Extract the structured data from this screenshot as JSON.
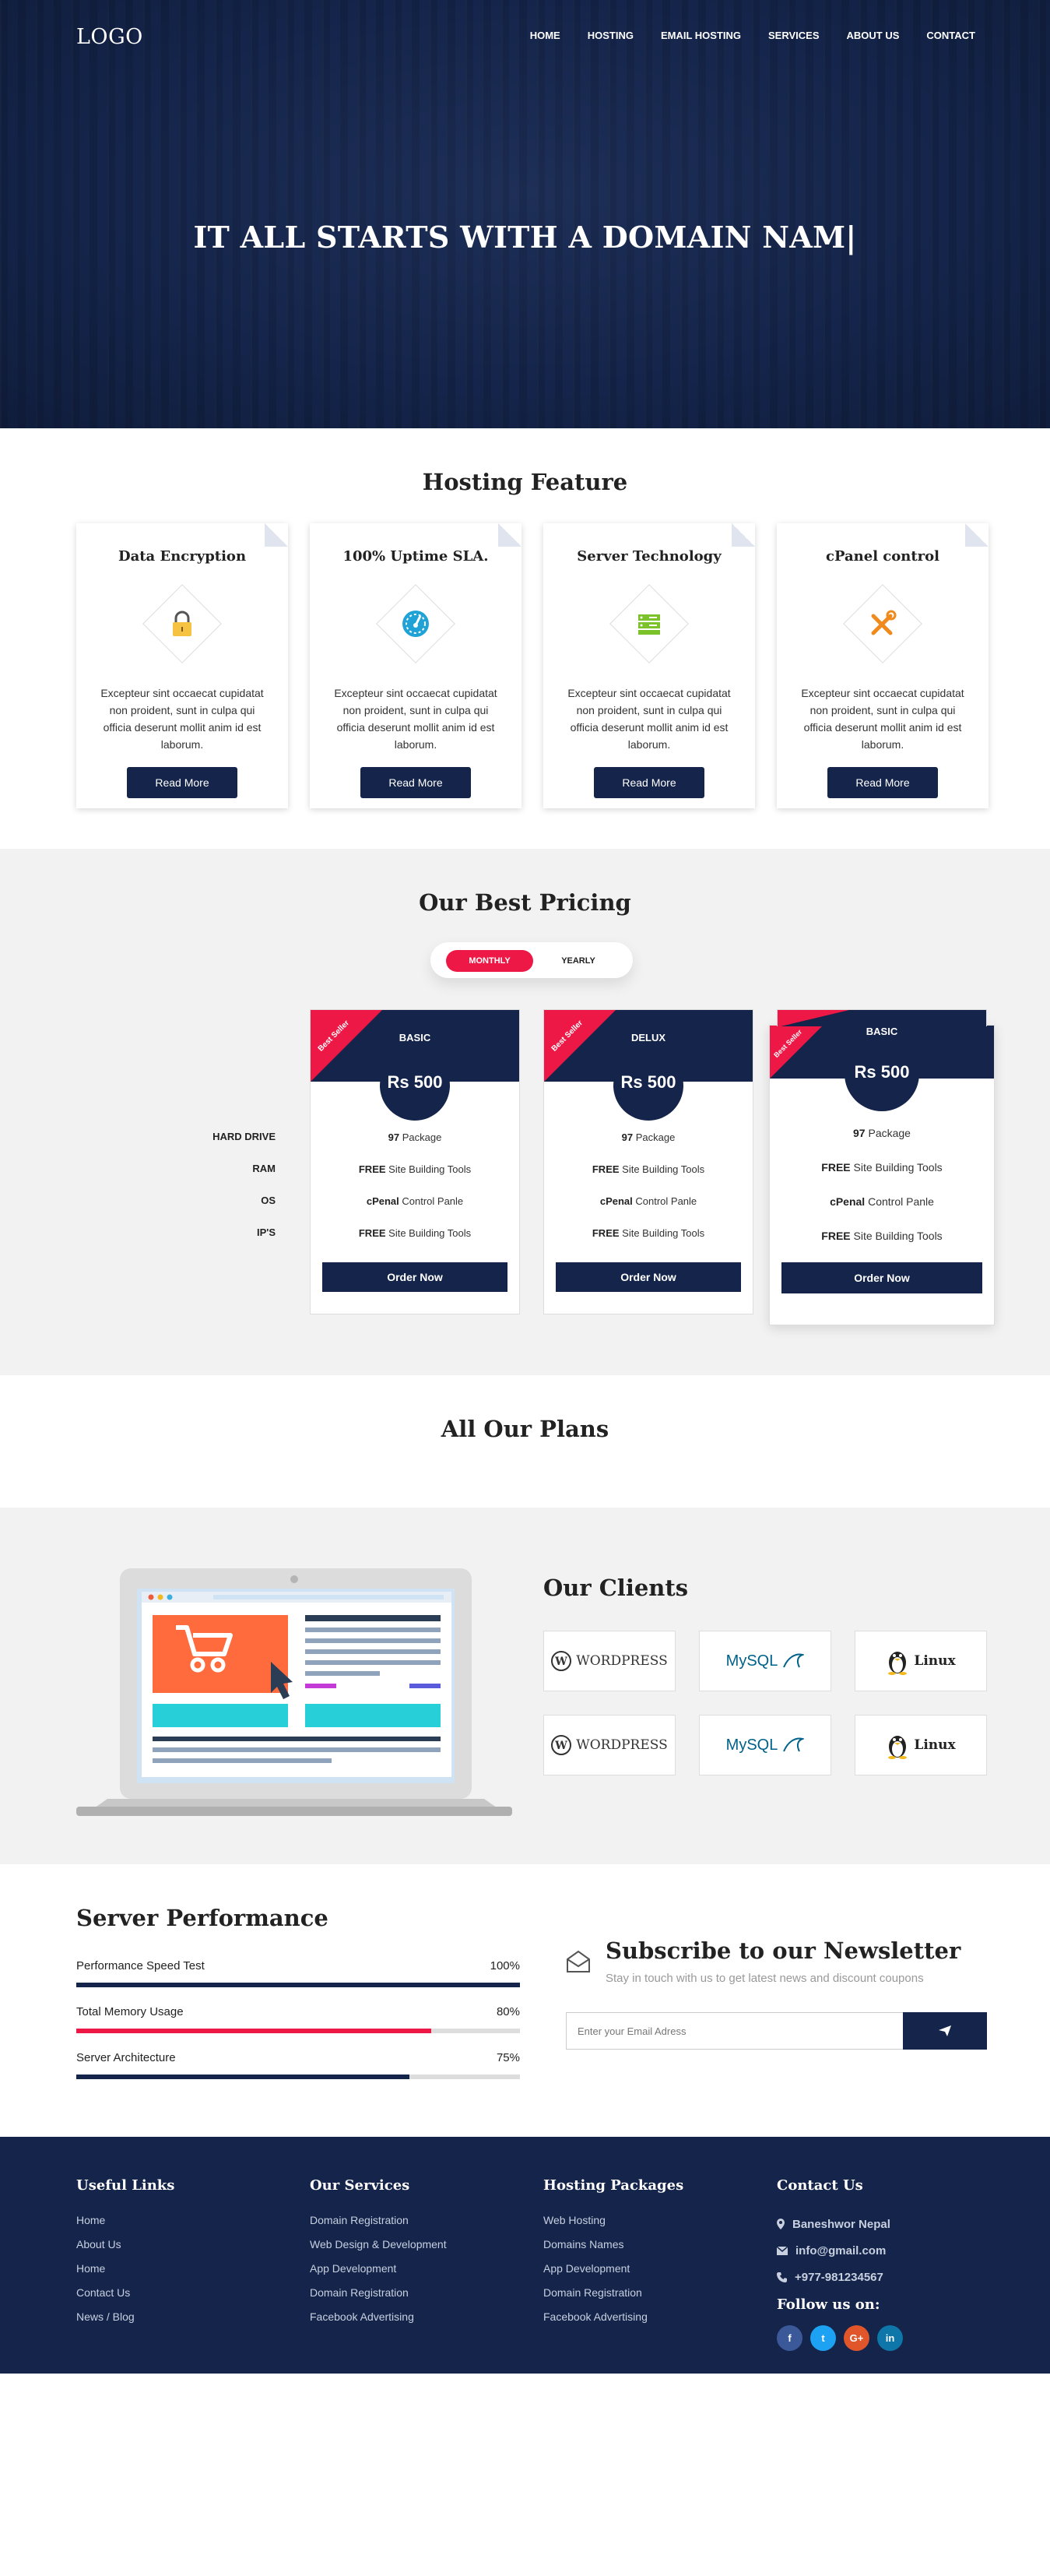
{
  "header": {
    "logo": "LOGO",
    "nav": [
      "HOME",
      "HOSTING",
      "EMAIL HOSTING",
      "SERVICES",
      "ABOUT US",
      "CONTACT"
    ],
    "hero_title": "IT ALL STARTS WITH A DOMAIN NAM|"
  },
  "features": {
    "title": "Hosting Feature",
    "cards": [
      {
        "title": "Data Encryption",
        "icon": "lock-icon",
        "text": "Excepteur sint occaecat cupidatat non proident, sunt in culpa qui officia deserunt mollit anim id est laborum.",
        "button": "Read More"
      },
      {
        "title": "100% Uptime SLA.",
        "icon": "speedometer-icon",
        "text": "Excepteur sint occaecat cupidatat non proident, sunt in culpa qui officia deserunt mollit anim id est laborum.",
        "button": "Read More"
      },
      {
        "title": "Server Technology",
        "icon": "server-icon",
        "text": "Excepteur sint occaecat cupidatat non proident, sunt in culpa qui officia deserunt mollit anim id est laborum.",
        "button": "Read More"
      },
      {
        "title": "cPanel control",
        "icon": "tools-icon",
        "text": "Excepteur sint occaecat cupidatat non proident, sunt in culpa qui officia deserunt mollit anim id est laborum.",
        "button": "Read More"
      }
    ]
  },
  "pricing": {
    "title": "Our Best Pricing",
    "toggle": {
      "active": "MONTHLY",
      "inactive": "YEARLY"
    },
    "row_labels": [
      "HARD DRIVE",
      "RAM",
      "OS",
      "IP'S"
    ],
    "ribbon": "Best Seller",
    "plans": [
      {
        "name": "BASIC",
        "price": "Rs 500",
        "features": [
          [
            "97",
            " Package"
          ],
          [
            "FREE",
            " Site Building Tools"
          ],
          [
            "cPenal",
            " Control Panle"
          ],
          [
            "FREE",
            " Site Building Tools"
          ]
        ],
        "button": "Order Now"
      },
      {
        "name": "DELUX",
        "price": "Rs 500",
        "features": [
          [
            "97",
            " Package"
          ],
          [
            "FREE",
            " Site Building Tools"
          ],
          [
            "cPenal",
            " Control Panle"
          ],
          [
            "FREE",
            " Site Building Tools"
          ]
        ],
        "button": "Order Now"
      },
      {
        "name": "BASIC",
        "price": "Rs 500",
        "features": [
          [
            "97",
            " Package"
          ],
          [
            "FREE",
            " Site Building Tools"
          ],
          [
            "cPenal",
            " Control Panle"
          ],
          [
            "FREE",
            " Site Building Tools"
          ]
        ],
        "button": "Order Now"
      }
    ]
  },
  "plans_section": {
    "title": "All Our Plans"
  },
  "clients": {
    "title": "Our Clients",
    "logos": [
      {
        "name": "WORDPRESS",
        "icon": "wordpress-logo"
      },
      {
        "name": "MySQL",
        "icon": "mysql-logo"
      },
      {
        "name": "Linux",
        "icon": "linux-logo"
      },
      {
        "name": "WORDPRESS",
        "icon": "wordpress-logo"
      },
      {
        "name": "MySQL",
        "icon": "mysql-logo"
      },
      {
        "name": "Linux",
        "icon": "linux-logo"
      }
    ]
  },
  "performance": {
    "title": "Server Performance",
    "bars": [
      {
        "label": "Performance Speed Test",
        "value": "100%",
        "percent": 100,
        "color": "#14244a"
      },
      {
        "label": "Total Memory Usage",
        "value": "80%",
        "percent": 80,
        "color": "#ee1846"
      },
      {
        "label": "Server Architecture",
        "value": "75%",
        "percent": 75,
        "color": "#14244a"
      }
    ]
  },
  "newsletter": {
    "title": "Subscribe to our Newsletter",
    "subtitle": "Stay in touch with us to get latest news and discount coupons",
    "placeholder": "Enter your Email Adress"
  },
  "footer": {
    "useful_links": {
      "title": "Useful Links",
      "items": [
        "Home",
        "About Us",
        "Home",
        "Contact Us",
        "News / Blog"
      ]
    },
    "services": {
      "title": "Our Services",
      "items": [
        "Domain Registration",
        "Web Design & Development",
        "App Development",
        "Domain Registration",
        "Facebook Advertising"
      ]
    },
    "packages": {
      "title": "Hosting Packages",
      "items": [
        "Web Hosting",
        "Domains Names",
        "App Development",
        "Domain Registration",
        "Facebook Advertising"
      ]
    },
    "contact": {
      "title": "Contact Us",
      "location": "Baneshwor Nepal",
      "email": "info@gmail.com",
      "phone": "+977-981234567",
      "follow": "Follow us on:",
      "socials": [
        {
          "icon": "facebook-icon",
          "glyph": "f",
          "color": "#3b5998"
        },
        {
          "icon": "twitter-icon",
          "glyph": "t",
          "color": "#1da1f2"
        },
        {
          "icon": "google-plus-icon",
          "glyph": "G+",
          "color": "#e0562a"
        },
        {
          "icon": "linkedin-icon",
          "glyph": "in",
          "color": "#0e76a8"
        }
      ]
    }
  },
  "colors": {
    "navy": "#14244a",
    "accent": "#ee1846",
    "section_bg": "#f2f2f2"
  }
}
